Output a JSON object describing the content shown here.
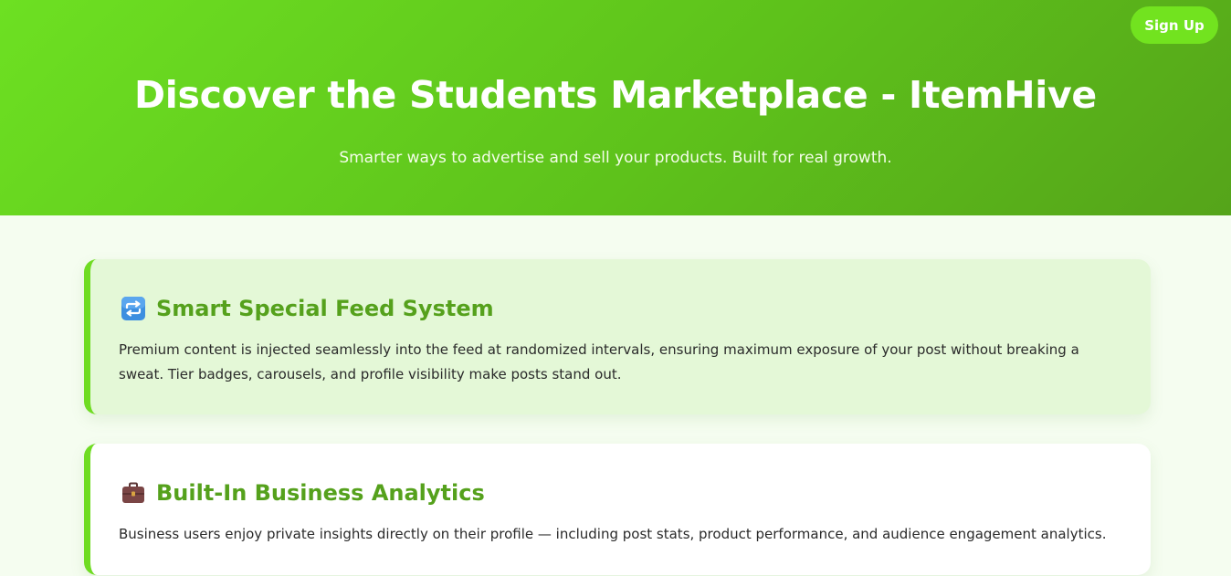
{
  "header": {
    "signup_label": "Sign Up",
    "title": "Discover the Students Marketplace - ItemHive",
    "subtitle": "Smarter ways to advertise and sell your products. Built for real growth."
  },
  "features": [
    {
      "icon": "repeat-arrows-icon",
      "title": "Smart Special Feed System",
      "text": "Premium content is injected seamlessly into the feed at randomized intervals, ensuring maximum exposure of your post without breaking a sweat. Tier badges, carousels, and profile visibility make posts stand out."
    },
    {
      "icon": "briefcase-icon",
      "title": "Built-In Business Analytics",
      "text": "Business users enjoy private insights directly on their profile — including post stats, product performance, and audience engagement analytics."
    }
  ],
  "colors": {
    "hero_gradient_start": "#6de022",
    "hero_gradient_end": "#55a41a",
    "accent": "#6fdc22",
    "title_green": "#55a11c",
    "page_background": "#f5fdf0"
  }
}
